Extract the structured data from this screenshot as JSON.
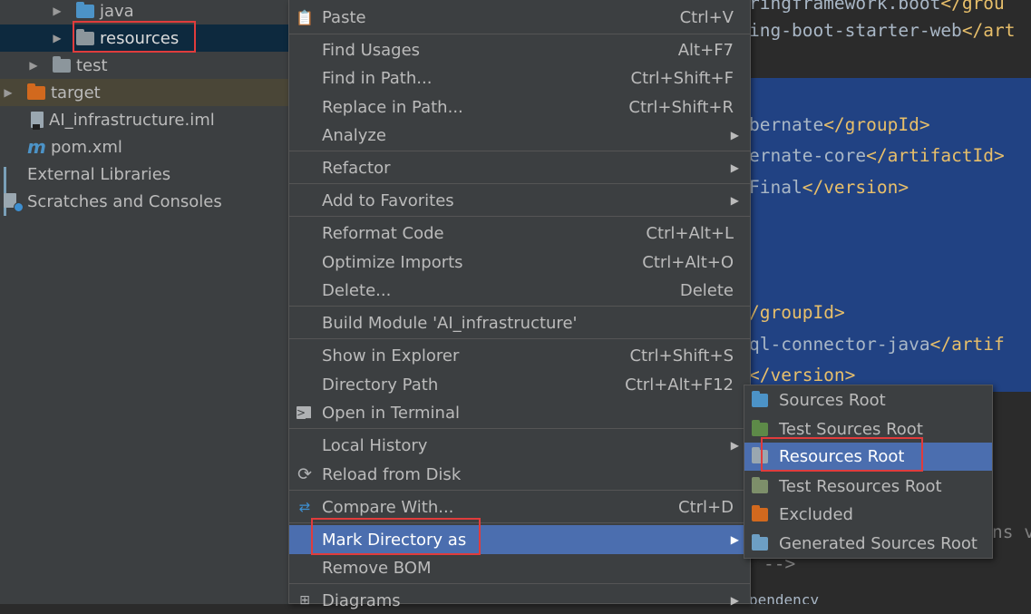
{
  "tree": {
    "items": [
      {
        "label": "java"
      },
      {
        "label": "resources"
      },
      {
        "label": "test"
      },
      {
        "label": "target"
      },
      {
        "label": "AI_infrastructure.iml"
      },
      {
        "label": "pom.xml"
      },
      {
        "label": "External Libraries"
      },
      {
        "label": "Scratches and Consoles"
      }
    ]
  },
  "context_menu": {
    "items": [
      {
        "label": "Paste",
        "shortcut": "Ctrl+V",
        "icon": "clipboard-icon"
      },
      {
        "label": "Find Usages",
        "shortcut": "Alt+F7"
      },
      {
        "label": "Find in Path...",
        "shortcut": "Ctrl+Shift+F"
      },
      {
        "label": "Replace in Path...",
        "shortcut": "Ctrl+Shift+R"
      },
      {
        "label": "Analyze",
        "submenu": true
      },
      {
        "label": "Refactor",
        "submenu": true
      },
      {
        "label": "Add to Favorites",
        "submenu": true
      },
      {
        "label": "Reformat Code",
        "shortcut": "Ctrl+Alt+L"
      },
      {
        "label": "Optimize Imports",
        "shortcut": "Ctrl+Alt+O"
      },
      {
        "label": "Delete...",
        "shortcut": "Delete"
      },
      {
        "label": "Build Module 'AI_infrastructure'"
      },
      {
        "label": "Show in Explorer",
        "shortcut": "Ctrl+Shift+S"
      },
      {
        "label": "Directory Path",
        "shortcut": "Ctrl+Alt+F12"
      },
      {
        "label": "Open in Terminal",
        "icon": "terminal-icon"
      },
      {
        "label": "Local History",
        "submenu": true
      },
      {
        "label": "Reload from Disk",
        "icon": "reload-icon"
      },
      {
        "label": "Compare With...",
        "shortcut": "Ctrl+D",
        "icon": "compare-icon"
      },
      {
        "label": "Mark Directory as",
        "submenu": true,
        "active": true
      },
      {
        "label": "Remove BOM"
      },
      {
        "label": "Diagrams",
        "submenu": true,
        "icon": "diagram-icon"
      }
    ]
  },
  "mark_submenu": {
    "items": [
      {
        "label": "Sources Root"
      },
      {
        "label": "Test Sources Root"
      },
      {
        "label": "Resources Root",
        "active": true
      },
      {
        "label": "Test Resources Root"
      },
      {
        "label": "Excluded"
      },
      {
        "label": "Generated Sources Root"
      }
    ]
  },
  "editor": {
    "lines": [
      [
        "ringframework.boot",
        "</",
        "grou"
      ],
      [
        "ing-boot-starter-web",
        "</",
        "art"
      ],
      [
        "bernate",
        "</",
        "groupId",
        ">"
      ],
      [
        "ernate-core",
        "</",
        "artifactId",
        ">"
      ],
      [
        "Final",
        "</",
        "version",
        ">"
      ],
      [
        "/",
        "groupId",
        ">"
      ],
      [
        "ql-connector-java",
        "</",
        "artif"
      ],
      [
        "</",
        "version",
        ">"
      ],
      [
        "ns ",
        "v"
      ],
      [
        "-->"
      ],
      [
        "pendency"
      ]
    ]
  },
  "colors": {
    "tree_bg": "#3c3f41",
    "tree_selected": "#0d293e",
    "menu_active": "#4b6eaf",
    "editor_selection": "#214283",
    "annotation_red": "#e03c3c"
  }
}
